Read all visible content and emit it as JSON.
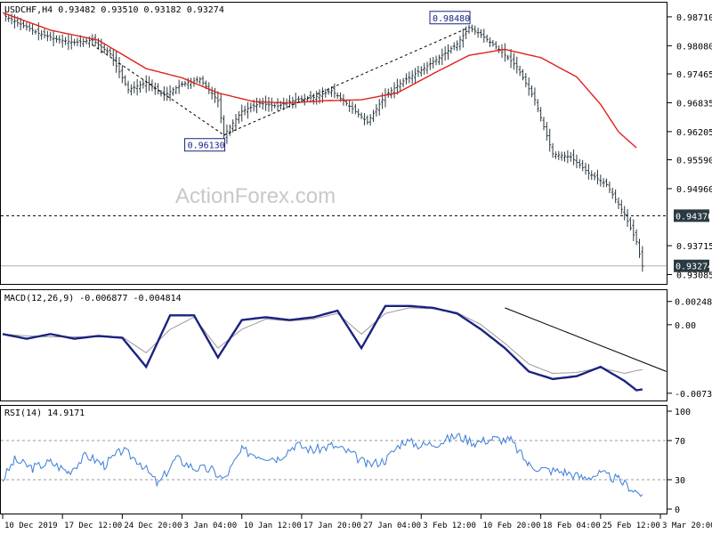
{
  "chart_data": {
    "type": "line",
    "watermark": "ActionForex.com",
    "price_panel": {
      "header": "USDCHF,H4  0.93482 0.93510 0.93182 0.93274",
      "ylim": [
        0.929,
        0.99
      ],
      "y_ticks": [
        "0.98710",
        "0.98080",
        "0.97465",
        "0.96835",
        "0.96205",
        "0.95590",
        "0.94960",
        "0.93715",
        "0.93085"
      ],
      "y_tick_values": [
        0.9871,
        0.9808,
        0.97465,
        0.96835,
        0.96205,
        0.9559,
        0.9496,
        0.93715,
        0.93085
      ],
      "level_label": "0.94370",
      "level_value": 0.9437,
      "last_label": "0.93274",
      "last_value": 0.93274,
      "annotations": [
        {
          "text": "0.96130",
          "x": 37,
          "value": 0.9613
        },
        {
          "text": "0.98480",
          "x": 78,
          "value": 0.9848
        }
      ],
      "x": [
        0,
        3,
        6,
        9,
        12,
        15,
        18,
        21,
        24,
        27,
        30,
        33,
        36,
        37,
        40,
        43,
        46,
        49,
        52,
        55,
        58,
        61,
        64,
        67,
        70,
        73,
        76,
        78,
        80,
        83,
        86,
        89,
        92,
        95,
        98,
        101,
        104,
        106,
        107
      ],
      "close": [
        0.9875,
        0.9855,
        0.9835,
        0.9822,
        0.9815,
        0.982,
        0.979,
        0.9712,
        0.9728,
        0.97,
        0.9724,
        0.9735,
        0.9688,
        0.9613,
        0.9665,
        0.9682,
        0.9676,
        0.969,
        0.9695,
        0.971,
        0.9676,
        0.9641,
        0.97,
        0.9731,
        0.9755,
        0.9782,
        0.9812,
        0.9848,
        0.9832,
        0.98,
        0.9762,
        0.969,
        0.9572,
        0.9565,
        0.953,
        0.9505,
        0.944,
        0.938,
        0.9327
      ],
      "ma_x": [
        0,
        8,
        16,
        24,
        30,
        36,
        42,
        48,
        54,
        60,
        66,
        72,
        78,
        84,
        90,
        96,
        100,
        103,
        106
      ],
      "ma": [
        0.988,
        0.9842,
        0.982,
        0.9758,
        0.9738,
        0.9705,
        0.9686,
        0.9683,
        0.9688,
        0.969,
        0.9705,
        0.9747,
        0.9787,
        0.98,
        0.9782,
        0.974,
        0.968,
        0.962,
        0.9585
      ]
    },
    "macd_panel": {
      "header": "MACD(12,26,9) -0.006877 -0.004814",
      "ylim": [
        -0.008,
        0.0035
      ],
      "y_ticks": [
        "0.002483",
        "0.00",
        "-0.007322"
      ],
      "y_tick_values": [
        0.002483,
        0.0,
        -0.007322
      ],
      "x": [
        0,
        4,
        8,
        12,
        16,
        20,
        24,
        28,
        32,
        36,
        40,
        44,
        48,
        52,
        56,
        60,
        64,
        68,
        72,
        76,
        80,
        84,
        88,
        92,
        96,
        100,
        104,
        106,
        107
      ],
      "macd": [
        -0.001,
        -0.0015,
        -0.001,
        -0.0015,
        -0.0012,
        -0.0014,
        -0.0045,
        0.001,
        0.001,
        -0.0035,
        0.0005,
        0.0008,
        0.0005,
        0.0008,
        0.0015,
        -0.0025,
        0.002,
        0.002,
        0.0018,
        0.0012,
        -0.0005,
        -0.0025,
        -0.005,
        -0.0058,
        -0.0055,
        -0.0045,
        -0.006,
        -0.007,
        -0.0069
      ],
      "signal": [
        -0.001,
        -0.0012,
        -0.0013,
        -0.0013,
        -0.0013,
        -0.0013,
        -0.003,
        -0.0005,
        0.0008,
        -0.0025,
        -0.0005,
        0.0006,
        0.0004,
        0.0006,
        0.0012,
        -0.001,
        0.0012,
        0.0018,
        0.0017,
        0.0013,
        0.0,
        -0.002,
        -0.0042,
        -0.0052,
        -0.0051,
        -0.0046,
        -0.0052,
        -0.0049,
        -0.0048
      ],
      "trendline": [
        [
          84,
          0.0018
        ],
        [
          111,
          -0.005
        ]
      ]
    },
    "rsi_panel": {
      "header": "RSI(14) 14.9171",
      "ylim": [
        0,
        100
      ],
      "y_ticks": [
        "100",
        "70",
        "30",
        "0"
      ],
      "y_tick_values": [
        100,
        70,
        30,
        0
      ],
      "x": [
        0,
        2,
        5,
        8,
        11,
        14,
        17,
        20,
        23,
        26,
        29,
        32,
        35,
        37,
        40,
        43,
        46,
        49,
        52,
        55,
        58,
        61,
        64,
        67,
        70,
        73,
        76,
        79,
        82,
        85,
        88,
        91,
        94,
        97,
        100,
        103,
        106,
        107
      ],
      "rsi": [
        30,
        50,
        42,
        48,
        38,
        55,
        45,
        60,
        48,
        25,
        52,
        42,
        40,
        30,
        60,
        55,
        52,
        66,
        60,
        65,
        58,
        45,
        50,
        70,
        65,
        68,
        75,
        68,
        72,
        70,
        45,
        40,
        38,
        32,
        36,
        30,
        18,
        15
      ]
    },
    "x_axis": {
      "labels": [
        "10 Dec 2019",
        "17 Dec 12:00",
        "24 Dec 20:00",
        "3 Jan 04:00",
        "10 Jan 12:00",
        "17 Jan 20:00",
        "27 Jan 04:00",
        "3 Feb 12:00",
        "10 Feb 20:00",
        "18 Feb 04:00",
        "25 Feb 12:00",
        "3 Mar 20:00"
      ],
      "label_positions": [
        0,
        10,
        20,
        30,
        40,
        50,
        60,
        70,
        80,
        90,
        100,
        110
      ],
      "xlim": [
        0,
        110
      ]
    }
  }
}
